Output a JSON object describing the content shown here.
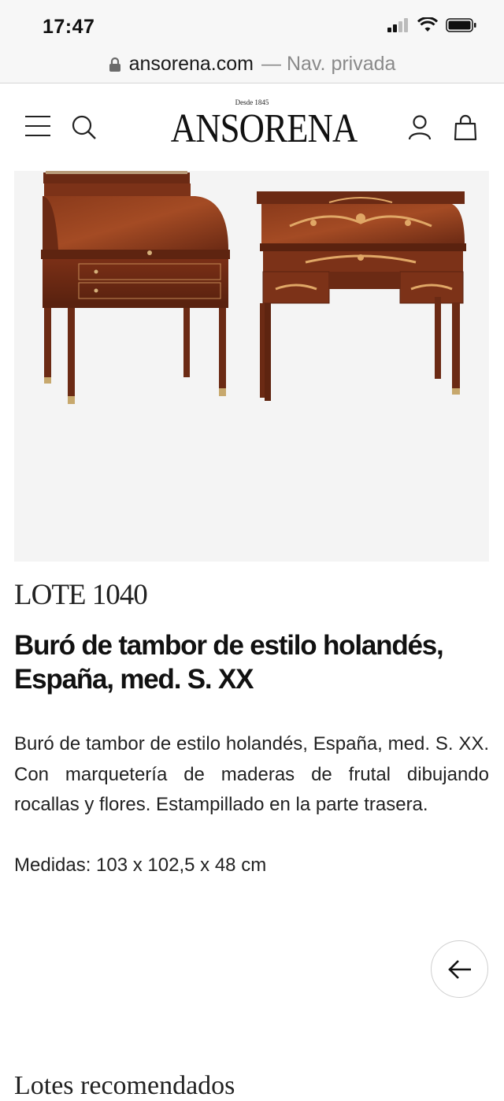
{
  "status": {
    "time": "17:47"
  },
  "browser": {
    "domain": "ansorena.com",
    "mode": "— Nav. privada"
  },
  "header": {
    "logo_tagline": "Desde 1845",
    "logo_name": "ANSORENA"
  },
  "icons": {
    "menu": "hamburger-menu-icon",
    "search": "search-icon",
    "user": "user-icon",
    "bag": "shopping-bag-icon",
    "back": "arrow-left-icon",
    "lock": "lock-icon"
  },
  "lot": {
    "number": "LOTE 1040",
    "title": "Buró de tambor de estilo holandés, España, med. S. XX",
    "description": "Buró de tambor de estilo holandés, España, med. S. XX. Con marquetería de maderas de frutal dibujando rocallas y flores. Estampillado en la parte trasera.",
    "measures": "Medidas: 103 x 102,5 x 48 cm"
  },
  "recommended": {
    "heading": "Lotes recomendados"
  },
  "colors": {
    "wood_dark": "#6b2a14",
    "wood_mid": "#8e3a1c",
    "inlay": "#d99a5a",
    "image_bg": "#f4f4f4"
  }
}
